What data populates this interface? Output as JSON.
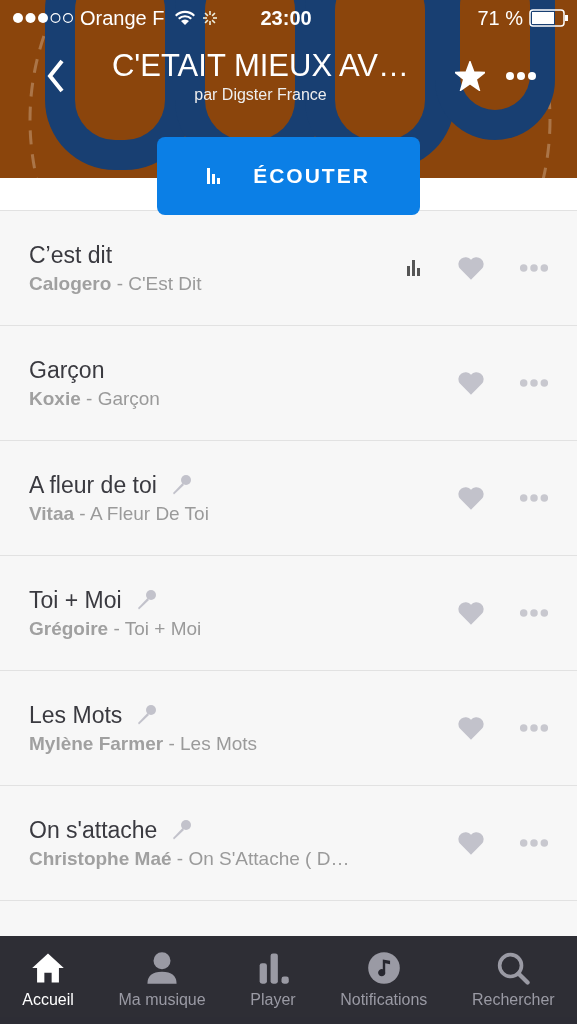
{
  "status_bar": {
    "carrier": "Orange F",
    "time": "23:00",
    "battery": "71 %"
  },
  "header": {
    "title": "C'ETAIT MIEUX AV…",
    "subtitle": "par Digster France",
    "favorite": true
  },
  "play_button": {
    "label": "ÉCOUTER"
  },
  "tracks": [
    {
      "title": "C’est dit",
      "subtitle": "**Calogero** - C'Est Dit",
      "lyrics": false,
      "playing": true
    },
    {
      "title": "Garçon",
      "subtitle": "**Koxie** - Garçon",
      "lyrics": false,
      "playing": false
    },
    {
      "title": "A fleur de toi",
      "subtitle": "**Vitaa** - A Fleur De Toi",
      "lyrics": true,
      "playing": false
    },
    {
      "title": "Toi + Moi",
      "subtitle": "**Grégoire** - Toi + Moi",
      "lyrics": true,
      "playing": false
    },
    {
      "title": "Les Mots",
      "subtitle": "**Mylène Farmer** - Les Mots",
      "lyrics": true,
      "playing": false
    },
    {
      "title": "On s'attache",
      "subtitle": "**Christophe Maé** - On S'Attache ( D…",
      "lyrics": true,
      "playing": false
    }
  ],
  "tab_bar": [
    {
      "label": "Accueil",
      "kind": "home",
      "selected": true
    },
    {
      "label": "Ma musique",
      "kind": "person",
      "selected": false
    },
    {
      "label": "Player",
      "kind": "bars",
      "selected": false
    },
    {
      "label": "Notifications",
      "kind": "note",
      "selected": false
    },
    {
      "label": "Rechercher",
      "kind": "search",
      "selected": false
    }
  ]
}
